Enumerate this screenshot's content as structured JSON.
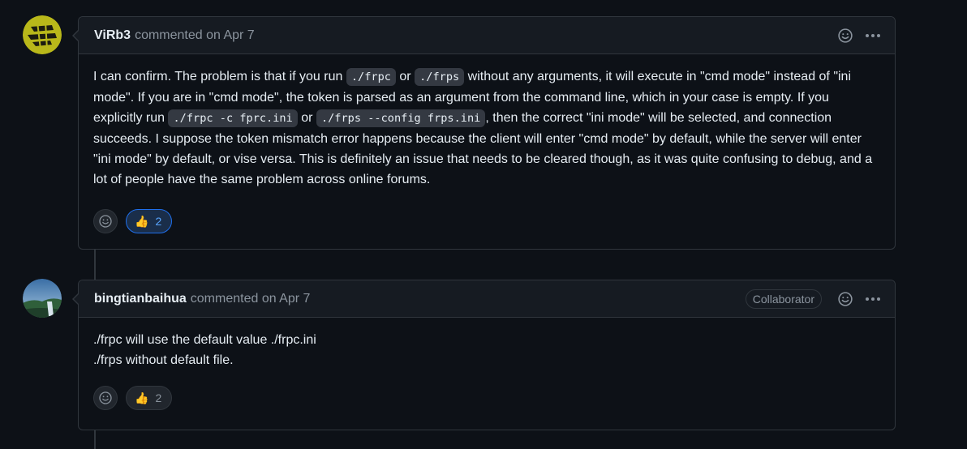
{
  "comments": [
    {
      "author": "ViRb3",
      "meta": "commented on Apr 7",
      "paragraphs": [
        [
          {
            "t": "text",
            "v": "I can confirm. The problem is that if you run "
          },
          {
            "t": "code",
            "v": "./frpc"
          },
          {
            "t": "text",
            "v": " or "
          },
          {
            "t": "code",
            "v": "./frps"
          },
          {
            "t": "text",
            "v": " without any arguments, it will execute in \"cmd mode\" instead of \"ini mode\". If you are in \"cmd mode\", the token is parsed as an argument from the command line, which in your case is empty. If you explicitly run "
          },
          {
            "t": "code",
            "v": "./frpc -c fprc.ini"
          },
          {
            "t": "text",
            "v": " or "
          },
          {
            "t": "code",
            "v": "./frps --config frps.ini"
          },
          {
            "t": "text",
            "v": ", then the correct \"ini mode\" will be selected, and connection succeeds. I suppose the token mismatch error happens because the client will enter \"cmd mode\" by default, while the server will enter \"ini mode\" by default, or vise versa. This is definitely an issue that needs to be cleared though, as it was quite confusing to debug, and a lot of people have the same problem across online forums."
          }
        ]
      ],
      "reaction": {
        "emoji": "👍",
        "count": "2",
        "active": true
      }
    },
    {
      "author": "bingtianbaihua",
      "meta": "commented on Apr 7",
      "badge": "Collaborator",
      "lines": [
        "./frpc will use the default value ./frpc.ini",
        "./frps without default file."
      ],
      "reaction": {
        "emoji": "👍",
        "count": "2",
        "active": false
      }
    }
  ],
  "icons": {
    "smiley": "smiley-icon",
    "kebab": "kebab-horizontal-icon"
  },
  "colors": {
    "background": "#0d1117",
    "header": "#161b22",
    "border": "#30363d",
    "muted": "#8b949e",
    "accent": "#58a6ff"
  }
}
